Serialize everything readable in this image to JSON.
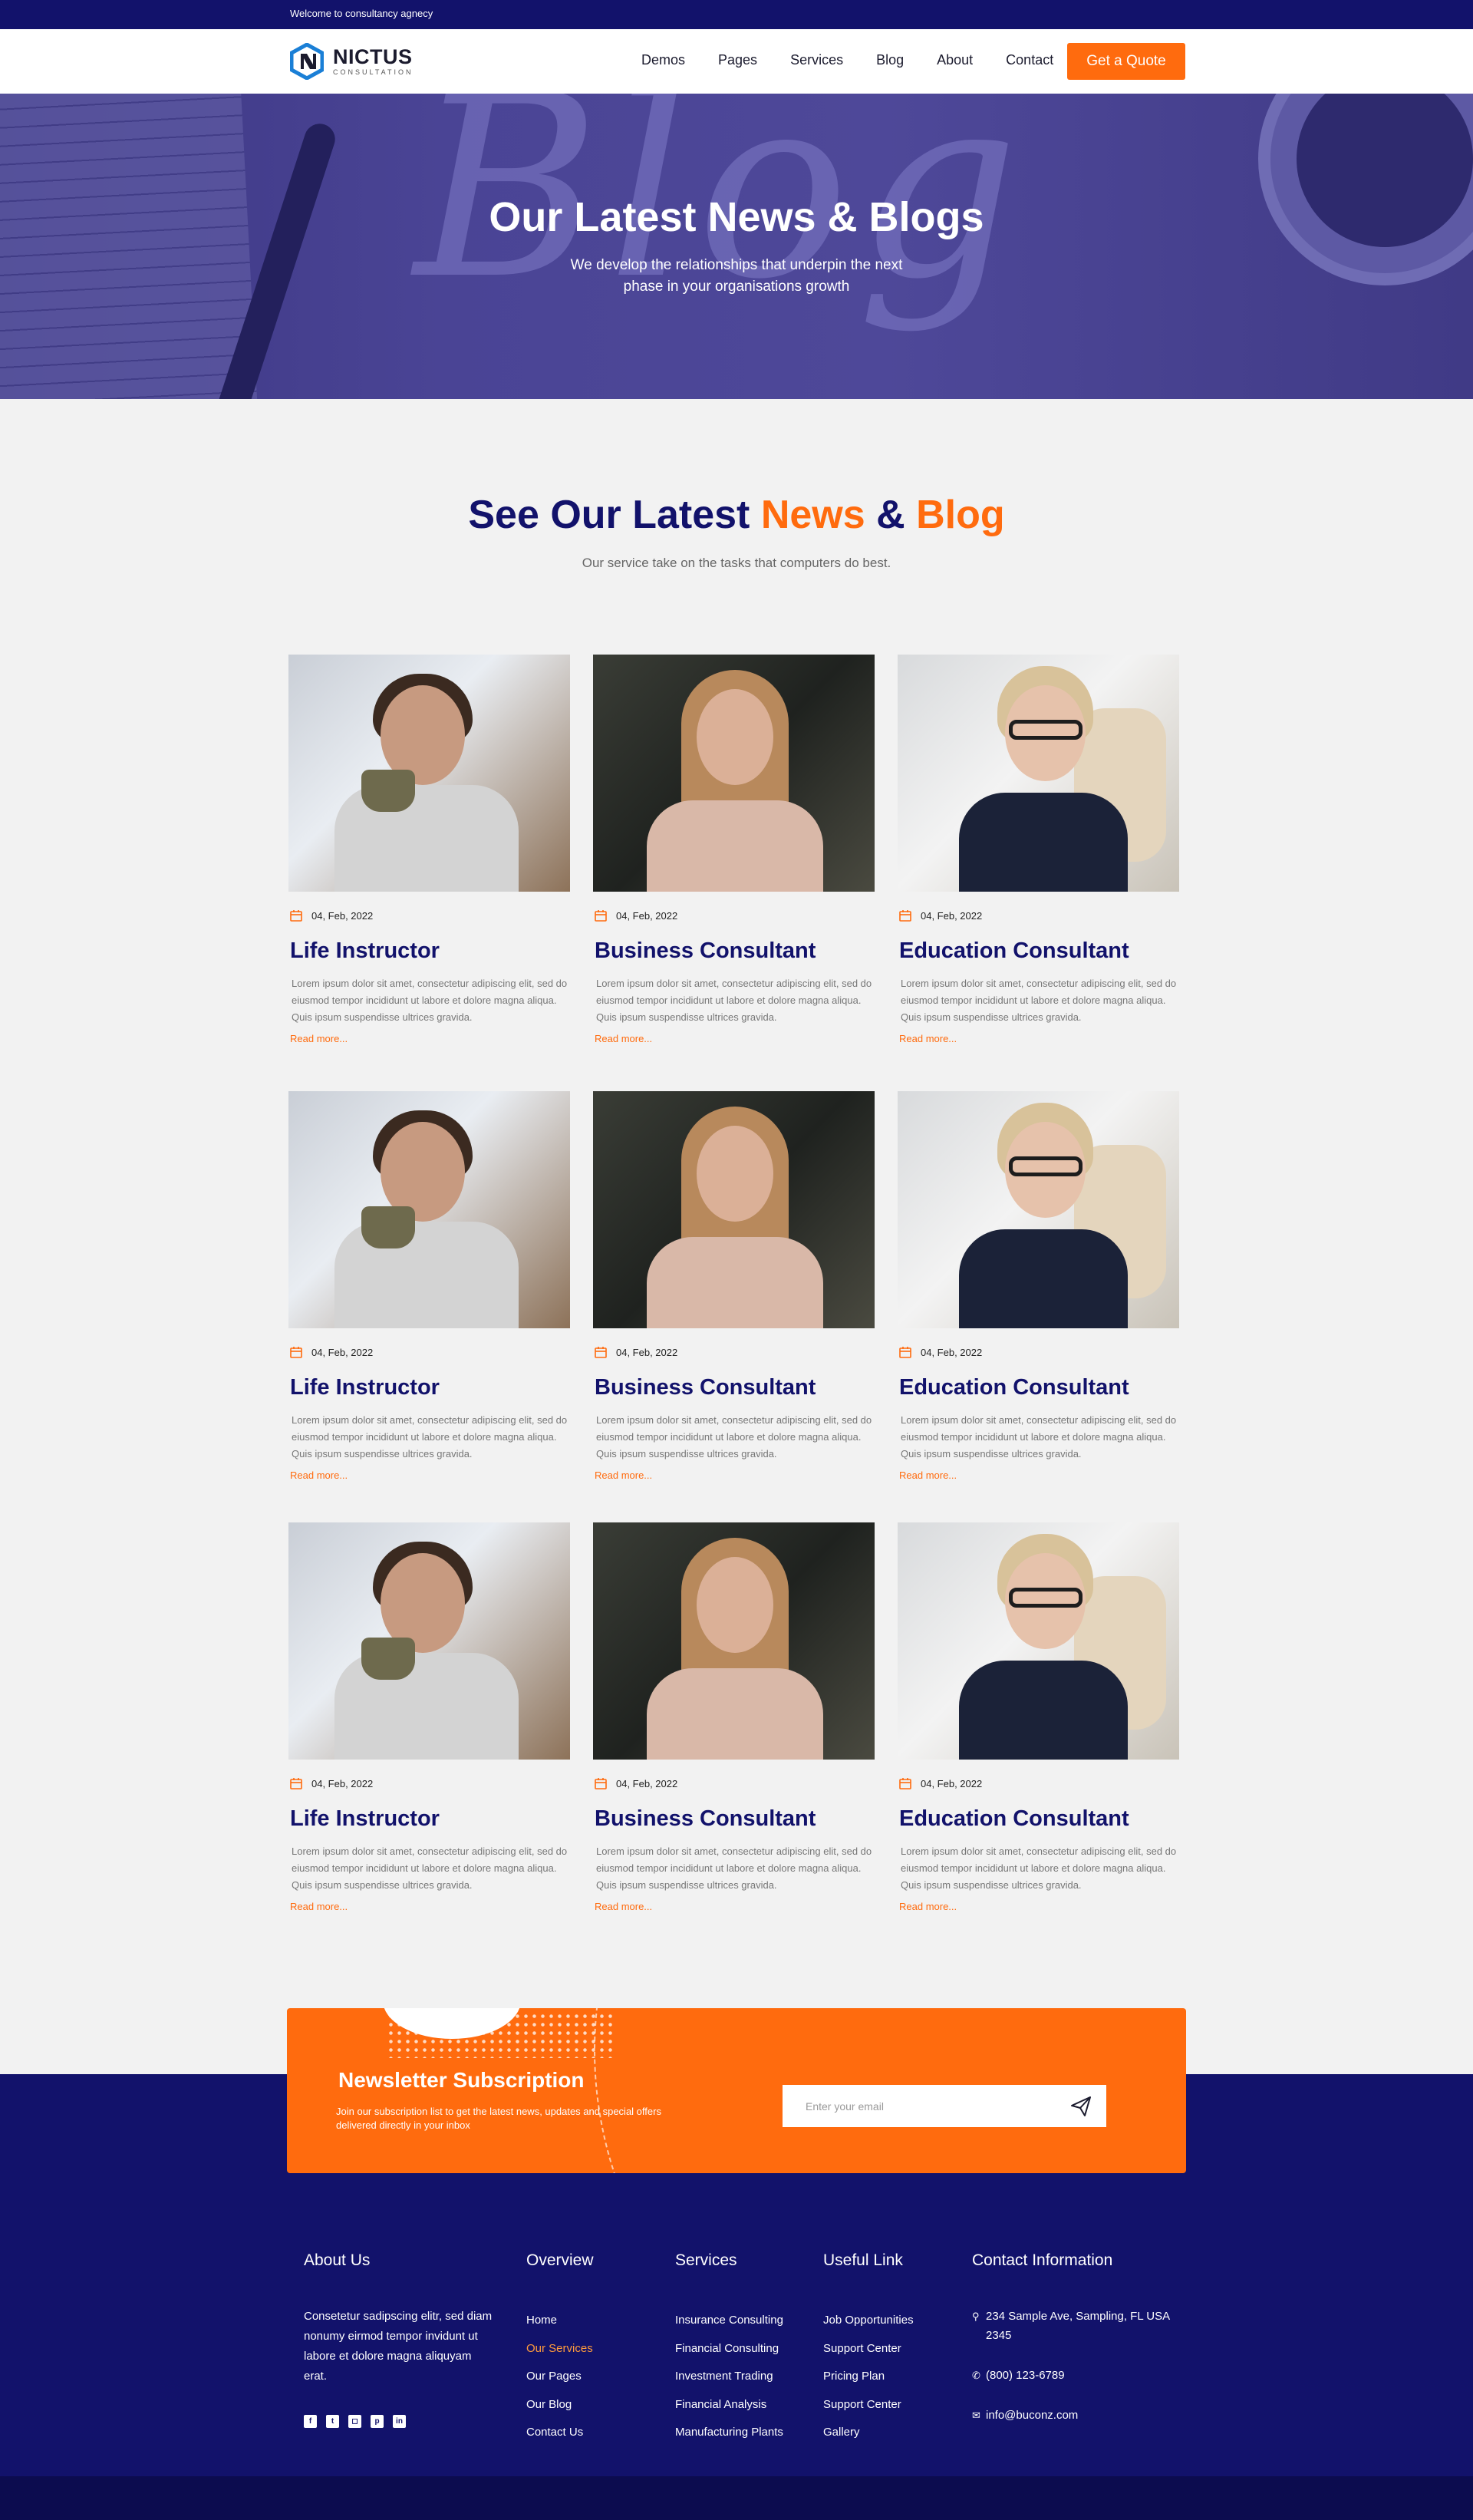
{
  "topbar": {
    "welcome": "Welcome to consultancy agnecy"
  },
  "brand": {
    "name": "NICTUS",
    "tagline": "CONSULTATION",
    "color": "#1a7fd6"
  },
  "nav": {
    "items": [
      "Demos",
      "Pages",
      "Services",
      "Blog",
      "About",
      "Contact"
    ],
    "cta": "Get a Quote"
  },
  "hero": {
    "watermark": "Blog",
    "title": "Our Latest News & Blogs",
    "subtitle": "We develop the relationships that underpin the next phase in your organisations growth"
  },
  "section": {
    "title_part1": "See Our Latest ",
    "title_accent1": "News",
    "title_mid": " & ",
    "title_accent2": "Blog",
    "subtitle": "Our service take on the tasks that computers do best."
  },
  "cards": [
    {
      "date": "04, Feb, 2022",
      "title": "Life Instructor",
      "desc": "Lorem ipsum dolor sit amet, consectetur adipiscing elit, sed do eiusmod tempor incididunt ut labore et dolore magna aliqua. Quis ipsum suspendisse ultrices gravida.",
      "more": "Read more..."
    },
    {
      "date": "04, Feb, 2022",
      "title": "Business Consultant",
      "desc": "Lorem ipsum dolor sit amet, consectetur adipiscing elit, sed do eiusmod tempor incididunt ut labore et dolore magna aliqua. Quis ipsum suspendisse ultrices gravida.",
      "more": "Read more..."
    },
    {
      "date": "04, Feb, 2022",
      "title": "Education Consultant",
      "desc": "Lorem ipsum dolor sit amet, consectetur adipiscing elit, sed do eiusmod tempor incididunt ut labore et dolore magna aliqua. Quis ipsum suspendisse ultrices gravida.",
      "more": "Read more..."
    },
    {
      "date": "04, Feb, 2022",
      "title": "Life Instructor",
      "desc": "Lorem ipsum dolor sit amet, consectetur adipiscing elit, sed do eiusmod tempor incididunt ut labore et dolore magna aliqua. Quis ipsum suspendisse ultrices gravida.",
      "more": "Read more..."
    },
    {
      "date": "04, Feb, 2022",
      "title": "Business Consultant",
      "desc": "Lorem ipsum dolor sit amet, consectetur adipiscing elit, sed do eiusmod tempor incididunt ut labore et dolore magna aliqua. Quis ipsum suspendisse ultrices gravida.",
      "more": "Read more..."
    },
    {
      "date": "04, Feb, 2022",
      "title": "Education Consultant",
      "desc": "Lorem ipsum dolor sit amet, consectetur adipiscing elit, sed do eiusmod tempor incididunt ut labore et dolore magna aliqua. Quis ipsum suspendisse ultrices gravida.",
      "more": "Read more..."
    },
    {
      "date": "04, Feb, 2022",
      "title": "Life Instructor",
      "desc": "Lorem ipsum dolor sit amet, consectetur adipiscing elit, sed do eiusmod tempor incididunt ut labore et dolore magna aliqua. Quis ipsum suspendisse ultrices gravida.",
      "more": "Read more..."
    },
    {
      "date": "04, Feb, 2022",
      "title": "Business Consultant",
      "desc": "Lorem ipsum dolor sit amet, consectetur adipiscing elit, sed do eiusmod tempor incididunt ut labore et dolore magna aliqua. Quis ipsum suspendisse ultrices gravida.",
      "more": "Read more..."
    },
    {
      "date": "04, Feb, 2022",
      "title": "Education Consultant",
      "desc": "Lorem ipsum dolor sit amet, consectetur adipiscing elit, sed do eiusmod tempor incididunt ut labore et dolore magna aliqua. Quis ipsum suspendisse ultrices gravida.",
      "more": "Read more..."
    }
  ],
  "newsletter": {
    "title": "Newsletter Subscription",
    "subtitle": "Join our subscription list to get the latest news, updates and special offers delivered directly in your inbox",
    "placeholder": "Enter your email",
    "icon": "send-icon"
  },
  "footer": {
    "about": {
      "heading": "About Us",
      "text": "Consetetur sadipscing elitr, sed diam nonumy eirmod tempor invidunt ut labore et dolore magna aliquyam erat.",
      "socials": [
        "facebook-icon",
        "twitter-icon",
        "instagram-icon",
        "pinterest-icon",
        "linkedin-icon"
      ]
    },
    "overview": {
      "heading": "Overview",
      "links": [
        "Home",
        "Our Services",
        "Our Pages",
        "Our Blog",
        "Contact Us"
      ],
      "active": "Our Services"
    },
    "services": {
      "heading": "Services",
      "links": [
        "Insurance Consulting",
        "Financial Consulting",
        "Investment Trading",
        "Financial Analysis",
        "Manufacturing Plants"
      ]
    },
    "useful": {
      "heading": "Useful Link",
      "links": [
        "Job Opportunities",
        "Support Center",
        "Pricing Plan",
        "Support Center",
        "Gallery"
      ]
    },
    "contact": {
      "heading": "Contact Information",
      "address": "234 Sample Ave, Sampling, FL USA 2345",
      "phone": "(800) 123-6789",
      "email": "info@buconz.com"
    }
  },
  "colors": {
    "navy": "#12126b",
    "orange": "#ff6b0e",
    "background": "#f2f2f2"
  }
}
